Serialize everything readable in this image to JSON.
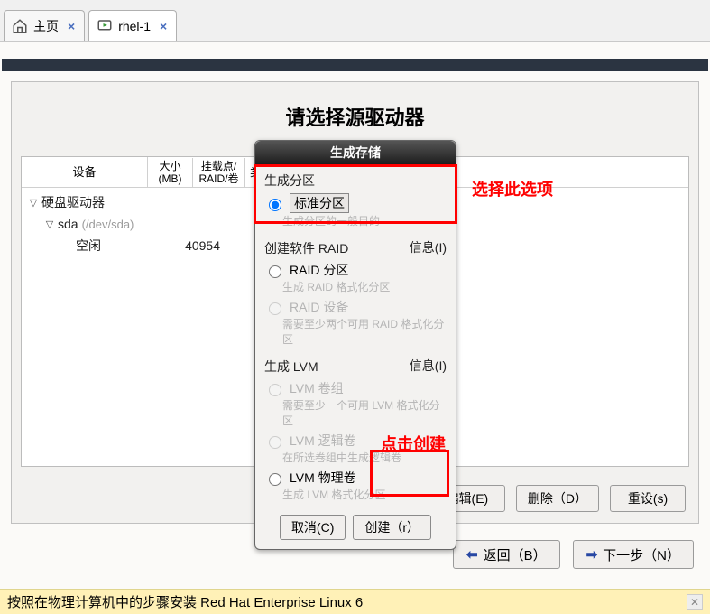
{
  "tabs": {
    "home": "主页",
    "vm": "rhel-1"
  },
  "installer": {
    "title": "请选择源驱动器",
    "columns": {
      "device": "设备",
      "size": "大小\n(MB)",
      "mount": "挂载点/\nRAID/卷",
      "type": "类型"
    },
    "tree": {
      "hdd": "硬盘驱动器",
      "sda": "sda",
      "sda_path": "(/dev/sda)",
      "free": "空闲",
      "free_size": "40954"
    },
    "buttons": {
      "edit": "编辑(E)",
      "delete": "删除（D）",
      "reset": "重设(s)"
    }
  },
  "modal": {
    "title": "生成存储",
    "section_create_part": "生成分区",
    "standard_part": "标准分区",
    "standard_desc": "生成分区的一般目的",
    "section_raid": "创建软件 RAID",
    "info": "信息(I)",
    "raid_part": "RAID 分区",
    "raid_part_desc": "生成 RAID 格式化分区",
    "raid_dev": "RAID 设备",
    "raid_dev_desc": "需要至少两个可用 RAID 格式化分区",
    "section_lvm": "生成 LVM",
    "lvm_vg": "LVM 卷组",
    "lvm_vg_desc": "需要至少一个可用 LVM 格式化分区",
    "lvm_lv": "LVM 逻辑卷",
    "lvm_lv_desc": "在所选卷组中生成逻辑卷",
    "lvm_pv": "LVM 物理卷",
    "lvm_pv_desc": "生成 LVM 格式化分区",
    "cancel": "取消(C)",
    "create": "创建（r）"
  },
  "nav": {
    "back": "返回（B）",
    "next": "下一步（N）"
  },
  "footer": {
    "text": "按照在物理计算机中的步骤安装 Red Hat Enterprise Linux 6"
  },
  "annotations": {
    "a1": "选择此选项",
    "a2": "点击创建"
  }
}
